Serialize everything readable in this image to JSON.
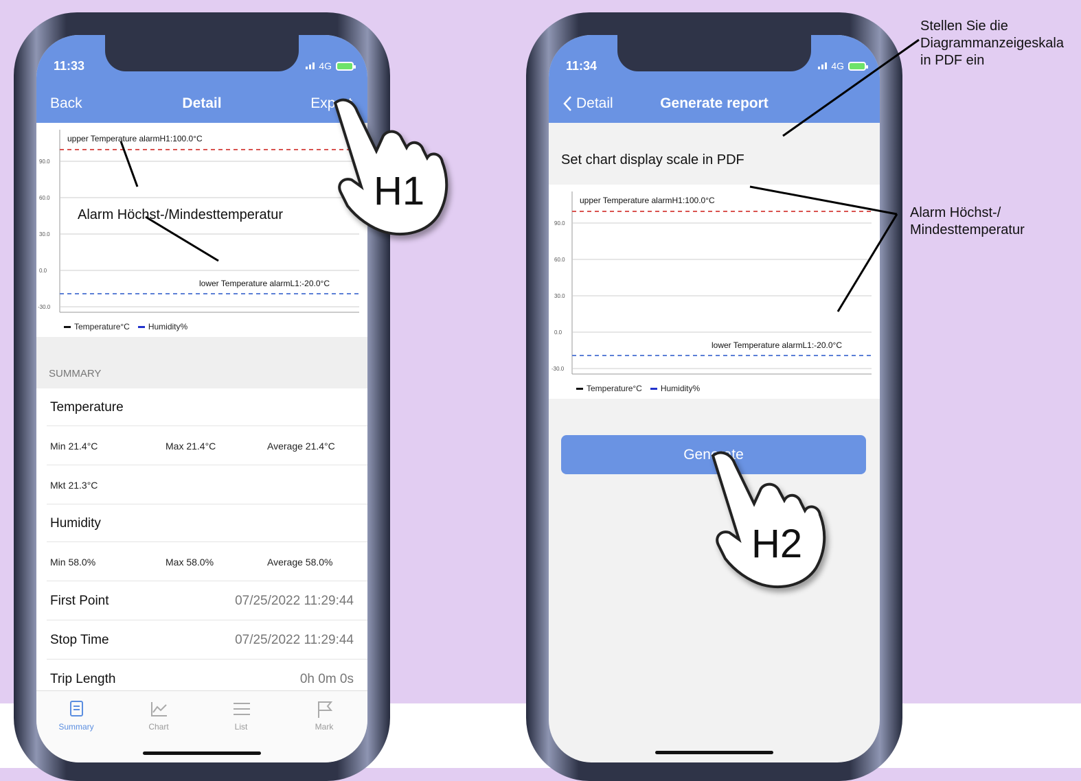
{
  "left_phone": {
    "status": {
      "time": "11:33",
      "network": "4G"
    },
    "nav": {
      "back": "Back",
      "title": "Detail",
      "action": "Export"
    },
    "chart": {
      "upper_label": "upper Temperature alarmH1:100.0°C",
      "lower_label": "lower Temperature alarmL1:-20.0°C",
      "ticks": [
        "90.0",
        "60.0",
        "30.0",
        "0.0",
        "-30.0"
      ],
      "legend": [
        "Temperature°C",
        "Humidity%"
      ],
      "annotation": "Alarm Höchst-/Mindesttemperatur"
    },
    "summary": {
      "header": "SUMMARY",
      "temperature_title": "Temperature",
      "temp_min": "Min 21.4°C",
      "temp_max": "Max 21.4°C",
      "temp_avg": "Average 21.4°C",
      "mkt": "Mkt 21.3°C",
      "humidity_title": "Humidity",
      "hum_min": "Min 58.0%",
      "hum_max": "Max 58.0%",
      "hum_avg": "Average 58.0%",
      "first_point_label": "First Point",
      "first_point_value": "07/25/2022 11:29:44",
      "stop_time_label": "Stop Time",
      "stop_time_value": "07/25/2022 11:29:44",
      "trip_length_label": "Trip Length",
      "trip_length_value": "0h 0m 0s"
    },
    "tabs": [
      "Summary",
      "Chart",
      "List",
      "Mark"
    ],
    "hand_label": "H1"
  },
  "right_phone": {
    "status": {
      "time": "11:34",
      "network": "4G"
    },
    "nav": {
      "back": "Detail",
      "title": "Generate report"
    },
    "subtitle": "Set chart display scale in PDF",
    "chart": {
      "upper_label": "upper Temperature alarmH1:100.0°C",
      "lower_label": "lower Temperature alarmL1:-20.0°C",
      "ticks": [
        "90.0",
        "60.0",
        "30.0",
        "0.0",
        "-30.0"
      ],
      "legend": [
        "Temperature°C",
        "Humidity%"
      ]
    },
    "generate_label": "Generate",
    "hand_label": "H2"
  },
  "annotations": {
    "scale_note": [
      "Stellen Sie die",
      "Diagrammanzeigeskala",
      "in PDF ein"
    ],
    "alarm_note": [
      "Alarm Höchst-/",
      "Mindesttemperatur"
    ]
  },
  "colors": {
    "accent": "#6a93e3",
    "upper_alarm": "#d9534f",
    "lower_alarm": "#5b7fd6",
    "background": "#e2cdf2"
  }
}
